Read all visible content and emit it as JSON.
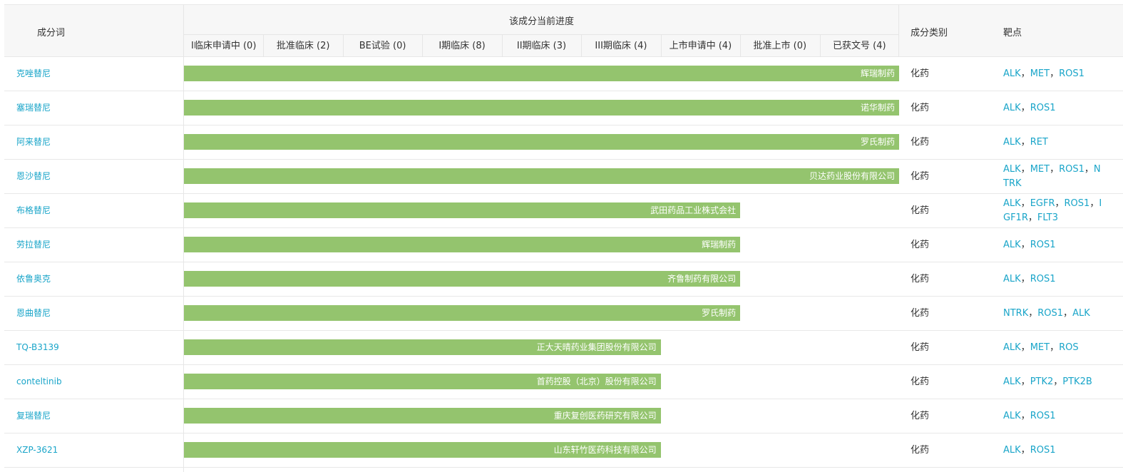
{
  "colors": {
    "bar": "#94c46e",
    "link": "#1aa5c9"
  },
  "header": {
    "ingredient": "成分词",
    "progress": "该成分当前进度",
    "category": "成分类别",
    "target": "靶点",
    "stages": [
      "I临床申请中 (0)",
      "批准临床 (2)",
      "BE试验 (0)",
      "I期临床 (8)",
      "II期临床 (3)",
      "III期临床 (4)",
      "上市申请中 (4)",
      "批准上市 (0)",
      "已获文号 (4)"
    ]
  },
  "rows": [
    {
      "name": "克唑替尼",
      "stage_reached": 9,
      "company": "辉瑞制药",
      "category": "化药",
      "targets": [
        "ALK",
        "MET",
        "ROS1"
      ]
    },
    {
      "name": "塞瑞替尼",
      "stage_reached": 9,
      "company": "诺华制药",
      "category": "化药",
      "targets": [
        "ALK",
        "ROS1"
      ]
    },
    {
      "name": "阿来替尼",
      "stage_reached": 9,
      "company": "罗氏制药",
      "category": "化药",
      "targets": [
        "ALK",
        "RET"
      ]
    },
    {
      "name": "恩沙替尼",
      "stage_reached": 9,
      "company": "贝达药业股份有限公司",
      "category": "化药",
      "targets": [
        "ALK",
        "MET",
        "ROS1",
        "NTRK"
      ]
    },
    {
      "name": "布格替尼",
      "stage_reached": 7,
      "company": "武田药品工业株式会社",
      "category": "化药",
      "targets": [
        "ALK",
        "EGFR",
        "ROS1",
        "IGF1R",
        "FLT3"
      ]
    },
    {
      "name": "劳拉替尼",
      "stage_reached": 7,
      "company": "辉瑞制药",
      "category": "化药",
      "targets": [
        "ALK",
        "ROS1"
      ]
    },
    {
      "name": "依鲁奥克",
      "stage_reached": 7,
      "company": "齐鲁制药有限公司",
      "category": "化药",
      "targets": [
        "ALK",
        "ROS1"
      ]
    },
    {
      "name": "恩曲替尼",
      "stage_reached": 7,
      "company": "罗氏制药",
      "category": "化药",
      "targets": [
        "NTRK",
        "ROS1",
        "ALK"
      ]
    },
    {
      "name": "TQ-B3139",
      "stage_reached": 6,
      "company": "正大天晴药业集团股份有限公司",
      "category": "化药",
      "targets": [
        "ALK",
        "MET",
        "ROS"
      ]
    },
    {
      "name": "conteltinib",
      "stage_reached": 6,
      "company": "首药控股（北京）股份有限公司",
      "category": "化药",
      "targets": [
        "ALK",
        "PTK2",
        "PTK2B"
      ]
    },
    {
      "name": "复瑞替尼",
      "stage_reached": 6,
      "company": "重庆复创医药研究有限公司",
      "category": "化药",
      "targets": [
        "ALK",
        "ROS1"
      ]
    },
    {
      "name": "XZP-3621",
      "stage_reached": 6,
      "company": "山东轩竹医药科技有限公司",
      "category": "化药",
      "targets": [
        "ALK",
        "ROS1"
      ]
    }
  ]
}
